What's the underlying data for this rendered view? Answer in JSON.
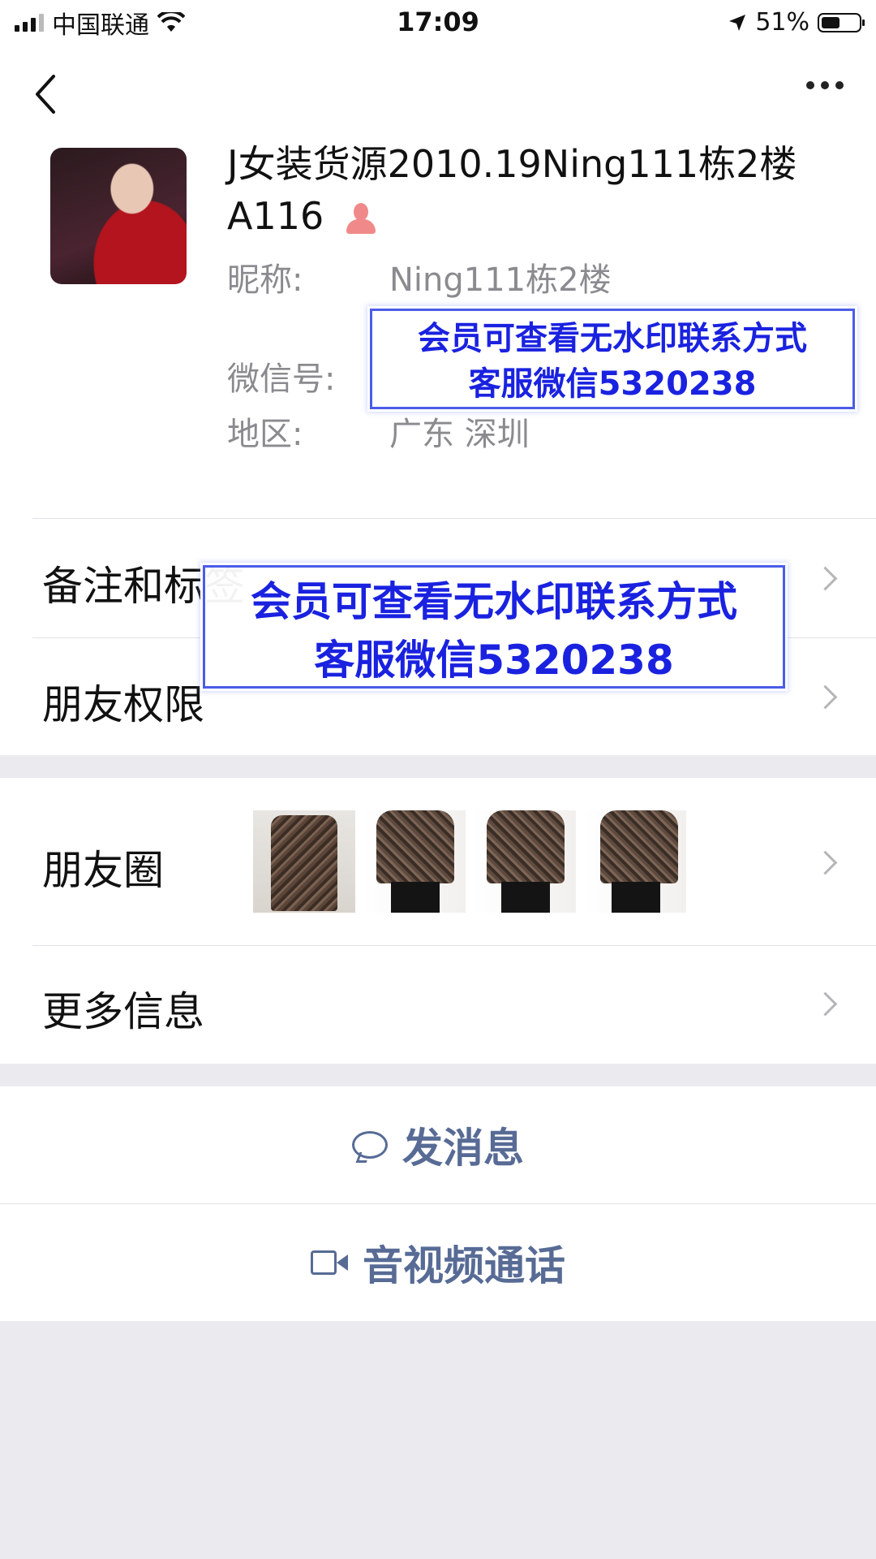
{
  "status_bar": {
    "carrier": "中国联通",
    "time": "17:09",
    "battery": "51%",
    "battery_level": 0.51,
    "icons": [
      "signal-icon",
      "wifi-icon",
      "location-arrow-icon",
      "battery-icon"
    ]
  },
  "nav": {
    "back_icon": "chevron-left-icon",
    "more_icon": "more-dots-icon"
  },
  "profile": {
    "name": "J女装货源2010.19Ning111栋2楼A116",
    "gender_icon": "female-icon",
    "nickname_label": "昵称:",
    "nickname_value": "Ning111栋2楼",
    "wechat_id_label": "微信号:",
    "region_label": "地区:",
    "region_value": "广东 深圳"
  },
  "watermark": {
    "line1": "会员可查看无水印联系方式",
    "line2": "客服微信5320238",
    "color": "#1a22e0"
  },
  "rows": {
    "remark": "备注和标签",
    "permissions": "朋友权限",
    "moments": "朋友圈",
    "more_info": "更多信息"
  },
  "actions": {
    "send_message": "发消息",
    "video_call": "音视频通话"
  },
  "colors": {
    "link": "#576b95",
    "page_bg": "#ebebef",
    "secondary_text": "#8a8a8f"
  }
}
